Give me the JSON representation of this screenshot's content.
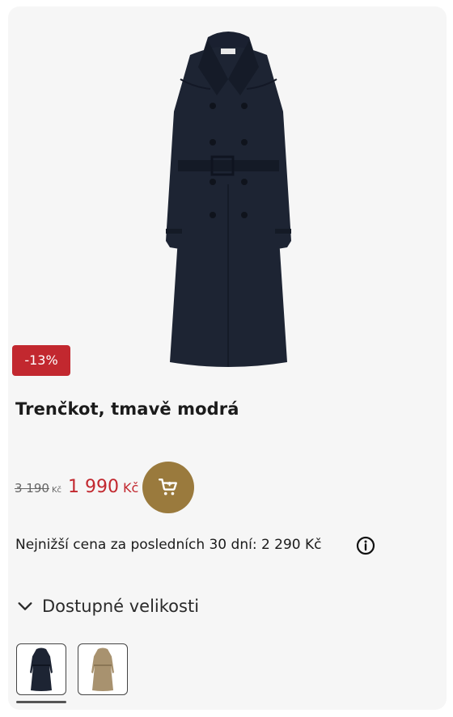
{
  "product": {
    "image_icon": "trench-coat-navy",
    "badge": "-13%",
    "title": "Trenčkot, tmavě modrá",
    "old_price": "3 190",
    "old_currency": "Kč",
    "new_price": "1 990",
    "new_currency": "Kč",
    "lowest_price_note": "Nejnižší cena za posledních 30 dní: 2 290 Kč",
    "sizes_label": "Dostupné velikosti"
  },
  "variants": [
    {
      "icon": "trench-coat-navy",
      "color": "#1d2433",
      "selected": true
    },
    {
      "icon": "trench-coat-beige",
      "color": "#a8926f",
      "selected": false
    }
  ],
  "colors": {
    "accent_red": "#c2282f",
    "cart_gold": "#9a7a3d",
    "coat_navy": "#1d2433",
    "coat_beige": "#a8926f"
  },
  "icons": {
    "cart": "shopping-cart-icon",
    "info": "info-icon",
    "chevron": "chevron-down-icon"
  }
}
